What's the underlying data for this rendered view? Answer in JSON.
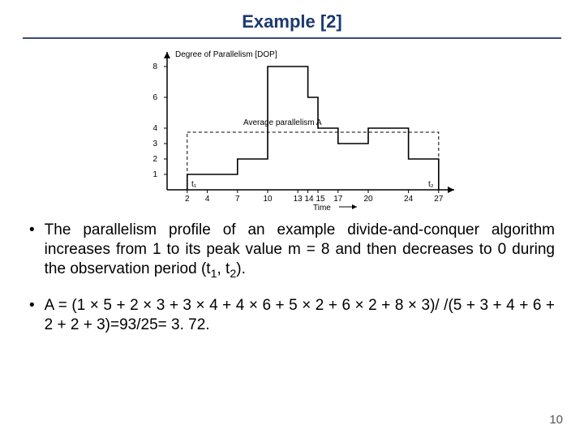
{
  "title": "Example [2]",
  "chart_data": {
    "type": "step",
    "ylabel": "Degree of Parallelism [DOP]",
    "xlabel": "Time",
    "xlim": [
      0,
      27
    ],
    "ylim": [
      0,
      8
    ],
    "x_ticks": [
      2,
      4,
      7,
      10,
      13,
      14,
      15,
      17,
      20,
      24,
      27
    ],
    "y_ticks": [
      1,
      2,
      3,
      4,
      6,
      8
    ],
    "average_label": "Average parallelism A",
    "average_value": 3.72,
    "t1_label": "t₁",
    "t2_label": "t₂",
    "segments": [
      {
        "x_start": 2,
        "x_end": 7,
        "value": 1
      },
      {
        "x_start": 7,
        "x_end": 10,
        "value": 2
      },
      {
        "x_start": 10,
        "x_end": 14,
        "value": 8
      },
      {
        "x_start": 14,
        "x_end": 15,
        "value": 6
      },
      {
        "x_start": 15,
        "x_end": 17,
        "value": 4
      },
      {
        "x_start": 17,
        "x_end": 20,
        "value": 3
      },
      {
        "x_start": 20,
        "x_end": 24,
        "value": 4
      },
      {
        "x_start": 24,
        "x_end": 27,
        "value": 2
      }
    ]
  },
  "bullets": {
    "b1_pre": "The parallelism profile of an example divide-and-conquer algorithm increases  from 1 to its peak value m = 8 and then decreases to 0 during the observation period (t",
    "b1_sub1": "1",
    "b1_sub2": "2",
    "b1_mid": ", t",
    "b1_end": ").",
    "b2": "A = (1 × 5 + 2 × 3 + 3 × 4 + 4 × 6 + 5 × 2 + 6 × 2 + 8 × 3)/ /(5 + 3 + 4 + 6 + 2 + 2 + 3)=93/25= 3. 72."
  },
  "page_number": "10"
}
